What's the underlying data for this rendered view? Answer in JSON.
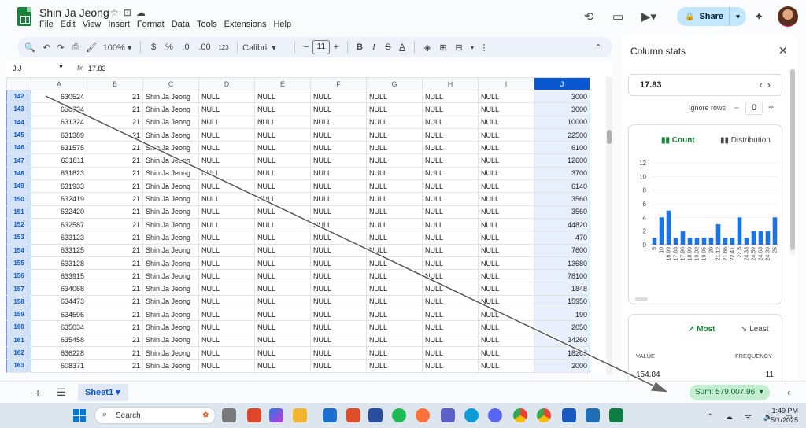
{
  "app": {
    "doc_title": "Shin Ja Jeong",
    "menu": [
      "File",
      "Edit",
      "View",
      "Insert",
      "Format",
      "Data",
      "Tools",
      "Extensions",
      "Help"
    ],
    "share_label": "Share",
    "accent": "#0b57d0",
    "brand_green": "#188038"
  },
  "toolbar": {
    "zoom": "100%",
    "currency": "$",
    "percent": "%",
    "decimals_decrease": ".0",
    "decimals_increase": ".00",
    "format_123": "123",
    "font": "Calibri",
    "font_size": "11",
    "bold": "B"
  },
  "formula_bar": {
    "name_box": "J:J",
    "fx": "fx",
    "value": "17.83"
  },
  "grid": {
    "columns": [
      "A",
      "B",
      "C",
      "D",
      "E",
      "F",
      "G",
      "H",
      "I",
      "J"
    ],
    "selected_column": "J",
    "rows": [
      {
        "n": "142",
        "a": "630524",
        "b": "21",
        "c": "Shin Ja Jeong",
        "d": "NULL",
        "e": "NULL",
        "f": "NULL",
        "g": "NULL",
        "h": "NULL",
        "i": "NULL",
        "j": "3000"
      },
      {
        "n": "143",
        "a": "630834",
        "b": "21",
        "c": "Shin Ja Jeong",
        "d": "NULL",
        "e": "NULL",
        "f": "NULL",
        "g": "NULL",
        "h": "NULL",
        "i": "NULL",
        "j": "3000"
      },
      {
        "n": "144",
        "a": "631324",
        "b": "21",
        "c": "Shin Ja Jeong",
        "d": "NULL",
        "e": "NULL",
        "f": "NULL",
        "g": "NULL",
        "h": "NULL",
        "i": "NULL",
        "j": "10000"
      },
      {
        "n": "145",
        "a": "631389",
        "b": "21",
        "c": "Shin Ja Jeong",
        "d": "NULL",
        "e": "NULL",
        "f": "NULL",
        "g": "NULL",
        "h": "NULL",
        "i": "NULL",
        "j": "22500"
      },
      {
        "n": "146",
        "a": "631575",
        "b": "21",
        "c": "Shin Ja Jeong",
        "d": "NULL",
        "e": "NULL",
        "f": "NULL",
        "g": "NULL",
        "h": "NULL",
        "i": "NULL",
        "j": "6100"
      },
      {
        "n": "147",
        "a": "631811",
        "b": "21",
        "c": "Shin Ja Jeong",
        "d": "NULL",
        "e": "NULL",
        "f": "NULL",
        "g": "NULL",
        "h": "NULL",
        "i": "NULL",
        "j": "12600"
      },
      {
        "n": "148",
        "a": "631823",
        "b": "21",
        "c": "Shin Ja Jeong",
        "d": "NULL",
        "e": "NULL",
        "f": "NULL",
        "g": "NULL",
        "h": "NULL",
        "i": "NULL",
        "j": "3700"
      },
      {
        "n": "149",
        "a": "631933",
        "b": "21",
        "c": "Shin Ja Jeong",
        "d": "NULL",
        "e": "NULL",
        "f": "NULL",
        "g": "NULL",
        "h": "NULL",
        "i": "NULL",
        "j": "6140"
      },
      {
        "n": "150",
        "a": "632419",
        "b": "21",
        "c": "Shin Ja Jeong",
        "d": "NULL",
        "e": "NULL",
        "f": "NULL",
        "g": "NULL",
        "h": "NULL",
        "i": "NULL",
        "j": "3560"
      },
      {
        "n": "151",
        "a": "632420",
        "b": "21",
        "c": "Shin Ja Jeong",
        "d": "NULL",
        "e": "NULL",
        "f": "NULL",
        "g": "NULL",
        "h": "NULL",
        "i": "NULL",
        "j": "3560"
      },
      {
        "n": "152",
        "a": "632587",
        "b": "21",
        "c": "Shin Ja Jeong",
        "d": "NULL",
        "e": "NULL",
        "f": "NULL",
        "g": "NULL",
        "h": "NULL",
        "i": "NULL",
        "j": "44820"
      },
      {
        "n": "153",
        "a": "633123",
        "b": "21",
        "c": "Shin Ja Jeong",
        "d": "NULL",
        "e": "NULL",
        "f": "NULL",
        "g": "NULL",
        "h": "NULL",
        "i": "NULL",
        "j": "470"
      },
      {
        "n": "154",
        "a": "633125",
        "b": "21",
        "c": "Shin Ja Jeong",
        "d": "NULL",
        "e": "NULL",
        "f": "NULL",
        "g": "NULL",
        "h": "NULL",
        "i": "NULL",
        "j": "7600"
      },
      {
        "n": "155",
        "a": "633128",
        "b": "21",
        "c": "Shin Ja Jeong",
        "d": "NULL",
        "e": "NULL",
        "f": "NULL",
        "g": "NULL",
        "h": "NULL",
        "i": "NULL",
        "j": "13680"
      },
      {
        "n": "156",
        "a": "633915",
        "b": "21",
        "c": "Shin Ja Jeong",
        "d": "NULL",
        "e": "NULL",
        "f": "NULL",
        "g": "NULL",
        "h": "NULL",
        "i": "NULL",
        "j": "78100"
      },
      {
        "n": "157",
        "a": "634068",
        "b": "21",
        "c": "Shin Ja Jeong",
        "d": "NULL",
        "e": "NULL",
        "f": "NULL",
        "g": "NULL",
        "h": "NULL",
        "i": "NULL",
        "j": "1848"
      },
      {
        "n": "158",
        "a": "634473",
        "b": "21",
        "c": "Shin Ja Jeong",
        "d": "NULL",
        "e": "NULL",
        "f": "NULL",
        "g": "NULL",
        "h": "NULL",
        "i": "NULL",
        "j": "15950"
      },
      {
        "n": "159",
        "a": "634596",
        "b": "21",
        "c": "Shin Ja Jeong",
        "d": "NULL",
        "e": "NULL",
        "f": "NULL",
        "g": "NULL",
        "h": "NULL",
        "i": "NULL",
        "j": "190"
      },
      {
        "n": "160",
        "a": "635034",
        "b": "21",
        "c": "Shin Ja Jeong",
        "d": "NULL",
        "e": "NULL",
        "f": "NULL",
        "g": "NULL",
        "h": "NULL",
        "i": "NULL",
        "j": "2050"
      },
      {
        "n": "161",
        "a": "635458",
        "b": "21",
        "c": "Shin Ja Jeong",
        "d": "NULL",
        "e": "NULL",
        "f": "NULL",
        "g": "NULL",
        "h": "NULL",
        "i": "NULL",
        "j": "34260"
      },
      {
        "n": "162",
        "a": "636228",
        "b": "21",
        "c": "Shin Ja Jeong",
        "d": "NULL",
        "e": "NULL",
        "f": "NULL",
        "g": "NULL",
        "h": "NULL",
        "i": "NULL",
        "j": "18260"
      },
      {
        "n": "163",
        "a": "608371",
        "b": "21",
        "c": "Shin Ja Jeong",
        "d": "NULL",
        "e": "NULL",
        "f": "NULL",
        "g": "NULL",
        "h": "NULL",
        "i": "NULL",
        "j": "2000"
      }
    ]
  },
  "bottom": {
    "add_sheet": "+",
    "sheet_tab": "Sheet1",
    "sum_label": "Sum: 579,007.96"
  },
  "panel": {
    "title": "Column stats",
    "current_value": "17.83",
    "ignore_rows_label": "Ignore rows",
    "ignore_rows_value": "0",
    "tab_count": "Count",
    "tab_distribution": "Distribution",
    "tab_most": "Most",
    "tab_least": "Least",
    "col_value": "VALUE",
    "col_frequency": "FREQUENCY",
    "top_value": "154.84",
    "top_frequency": "11"
  },
  "chart_data": {
    "type": "bar",
    "categories": [
      "5",
      "10",
      "16.99",
      "17.83",
      "17.96",
      "18.99",
      "19.02",
      "19.95",
      "20",
      "21.12",
      "21.86",
      "22.41",
      "22.5",
      "24.33",
      "24.59",
      "24.63",
      "24.39",
      "25"
    ],
    "values": [
      1,
      4,
      5,
      1,
      2,
      1,
      1,
      1,
      1,
      3,
      1,
      1,
      4,
      1,
      2,
      2,
      2,
      4
    ],
    "yticks": [
      "0",
      "2",
      "4",
      "6",
      "8",
      "10",
      "12"
    ],
    "ylim": [
      0,
      12
    ],
    "color": "#1a73e8"
  },
  "taskbar": {
    "search_label": "Search",
    "time": "1:49 PM",
    "date": "5/1/2025"
  }
}
